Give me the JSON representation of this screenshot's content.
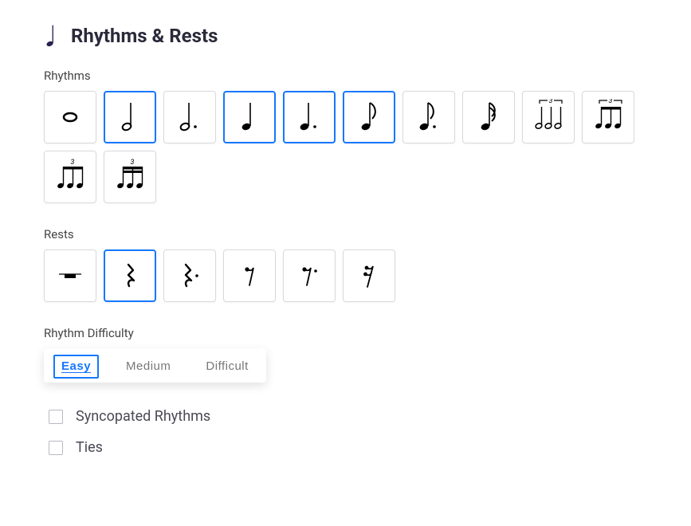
{
  "header": {
    "title": "Rhythms & Rests",
    "icon": "quarter-note-icon"
  },
  "sections": {
    "rhythms_label": "Rhythms",
    "rests_label": "Rests",
    "difficulty_label": "Rhythm Difficulty"
  },
  "rhythm_tiles": [
    {
      "name": "whole-note",
      "selected": false
    },
    {
      "name": "half-note",
      "selected": true
    },
    {
      "name": "dotted-half-note",
      "selected": false
    },
    {
      "name": "quarter-note",
      "selected": true
    },
    {
      "name": "dotted-quarter-note",
      "selected": true
    },
    {
      "name": "eighth-note",
      "selected": true
    },
    {
      "name": "dotted-eighth-note",
      "selected": false
    },
    {
      "name": "sixteenth-note",
      "selected": false
    },
    {
      "name": "eighth-triplet",
      "selected": false
    },
    {
      "name": "quarter-triplet",
      "selected": false
    },
    {
      "name": "eighth-triplet-beamed",
      "selected": false
    },
    {
      "name": "sixteenth-triplet-beamed",
      "selected": false
    }
  ],
  "rest_tiles": [
    {
      "name": "whole-rest",
      "selected": false
    },
    {
      "name": "quarter-rest",
      "selected": true
    },
    {
      "name": "dotted-quarter-rest",
      "selected": false
    },
    {
      "name": "eighth-rest",
      "selected": false
    },
    {
      "name": "dotted-eighth-rest",
      "selected": false
    },
    {
      "name": "sixteenth-rest",
      "selected": false
    }
  ],
  "difficulty": {
    "options": [
      "Easy",
      "Medium",
      "Difficult"
    ],
    "selected_index": 0
  },
  "checkboxes": {
    "syncopated": {
      "label": "Syncopated Rhythms",
      "checked": false
    },
    "ties": {
      "label": "Ties",
      "checked": false
    }
  },
  "colors": {
    "accent": "#1677ff",
    "text": "#2a2a3a"
  }
}
